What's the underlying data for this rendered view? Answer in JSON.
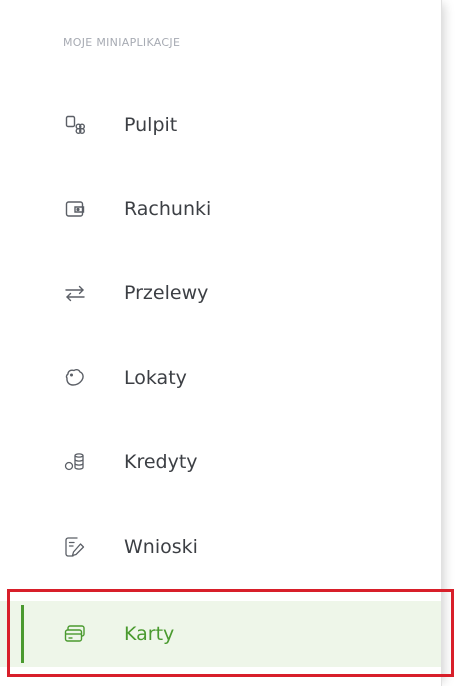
{
  "menu": {
    "section_title": "MOJE MINIAPLIKACJE",
    "accent_color": "#4a9a2f",
    "highlight_color": "#d81f2a",
    "items": [
      {
        "label": "Pulpit",
        "icon": "dashboard-icon",
        "active": false
      },
      {
        "label": "Rachunki",
        "icon": "wallet-icon",
        "active": false
      },
      {
        "label": "Przelewy",
        "icon": "transfer-arrows-icon",
        "active": false
      },
      {
        "label": "Lokaty",
        "icon": "piggy-bank-icon",
        "active": false
      },
      {
        "label": "Kredyty",
        "icon": "coins-icon",
        "active": false
      },
      {
        "label": "Wnioski",
        "icon": "document-pen-icon",
        "active": false
      },
      {
        "label": "Karty",
        "icon": "cards-icon",
        "active": true
      }
    ]
  }
}
